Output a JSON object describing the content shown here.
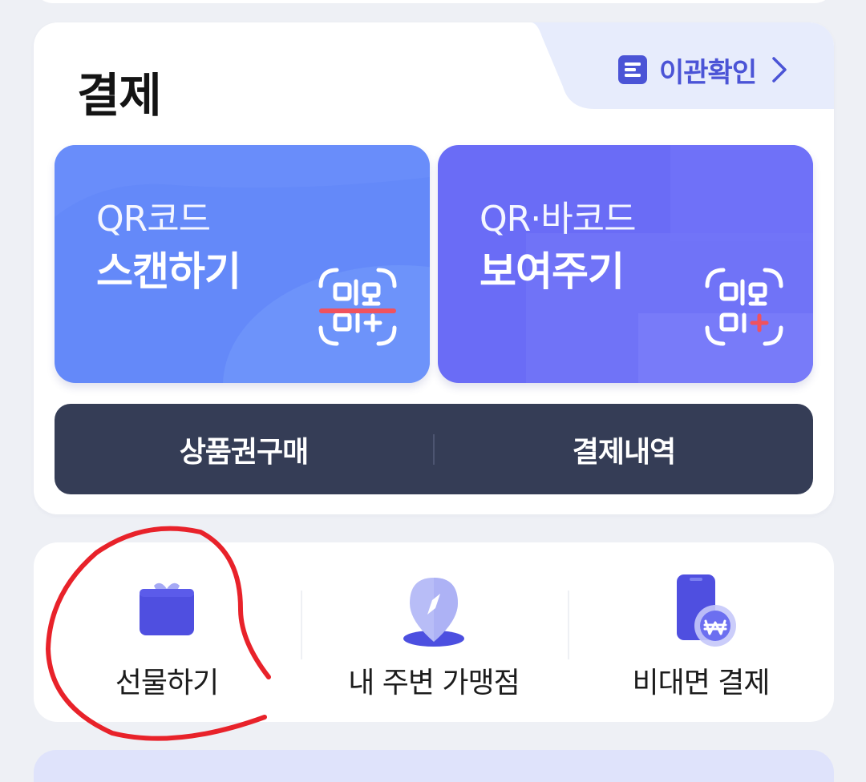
{
  "payment": {
    "title": "결제",
    "transfer_link": "이관확인",
    "scan_tile": {
      "sub": "QR코드",
      "main": "스캔하기"
    },
    "show_tile": {
      "sub": "QR·바코드",
      "main": "보여주기"
    },
    "bar": {
      "left": "상품권구매",
      "right": "결제내역"
    }
  },
  "shortcuts": {
    "items": [
      {
        "label": "선물하기",
        "icon": "gift-icon"
      },
      {
        "label": "내 주변 가맹점",
        "icon": "map-pin-icon"
      },
      {
        "label": "비대면 결제",
        "icon": "phone-won-icon"
      }
    ]
  },
  "colors": {
    "accent": "#4b54d6",
    "scan_tile": "#6489f9",
    "show_tile": "#6a6cf6",
    "dark_bar": "#353d56",
    "annotation": "#e8222a"
  }
}
